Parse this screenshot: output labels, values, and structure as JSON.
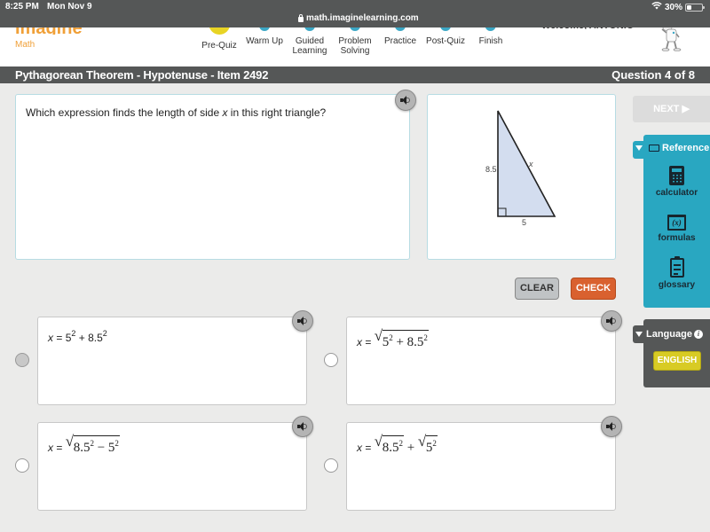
{
  "ios": {
    "time": "8:25 PM",
    "date": "Mon Nov 9",
    "url": "math.imaginelearning.com",
    "battery": "30%",
    "battery_level": 0.3
  },
  "header": {
    "logo_top": "Imagine",
    "logo_bottom": "Math",
    "welcome": "Welcome, ANTONIO",
    "steps": [
      {
        "label": "Pre-Quiz",
        "active": true
      },
      {
        "label": "Warm Up",
        "active": false
      },
      {
        "label": "Guided Learning",
        "active": false
      },
      {
        "label": "Problem Solving",
        "active": false
      },
      {
        "label": "Practice",
        "active": false
      },
      {
        "label": "Post-Quiz",
        "active": false
      },
      {
        "label": "Finish",
        "active": false
      }
    ]
  },
  "titlebar": {
    "title": "Pythagorean Theorem - Hypotenuse - Item 2492",
    "question_counter": "Question 4 of 8"
  },
  "question": {
    "text_before": "Which expression finds the length of side ",
    "variable": "x",
    "text_after": " in this right triangle?"
  },
  "figure": {
    "vertical_leg": "8.5",
    "horizontal_leg": "5",
    "hypotenuse": "x",
    "fill_color": "#d3ddef"
  },
  "buttons": {
    "clear": "CLEAR",
    "check": "CHECK",
    "next": "NEXT ▶"
  },
  "answers": [
    {
      "lhs": "x",
      "eq": " = ",
      "selected": true,
      "parts": [
        "5",
        "2",
        " + 8.5",
        "2"
      ]
    },
    {
      "lhs": "x",
      "eq": " = ",
      "selected": false,
      "radicand": [
        "5",
        "2",
        " + 8.5",
        "2"
      ]
    },
    {
      "lhs": "x",
      "eq": " = ",
      "selected": false,
      "radicand": [
        "8.5",
        "2",
        " − 5",
        "2"
      ]
    },
    {
      "lhs": "x",
      "eq": " = ",
      "selected": false,
      "radicand_a": [
        "8.5",
        "2"
      ],
      "op": " + ",
      "radicand_b": [
        "5",
        "2"
      ]
    }
  ],
  "reference": {
    "title": "Reference",
    "items": [
      "calculator",
      "formulas",
      "glossary"
    ],
    "formulas_glyph": "(x)"
  },
  "language": {
    "title": "Language",
    "info_glyph": "i",
    "current": "ENGLISH"
  },
  "colors": {
    "accent_teal": "#29a7c1",
    "check_orange": "#d9612f",
    "step_active": "#e8d424",
    "brand_orange": "#f0a038",
    "dark_bar": "#555757"
  }
}
